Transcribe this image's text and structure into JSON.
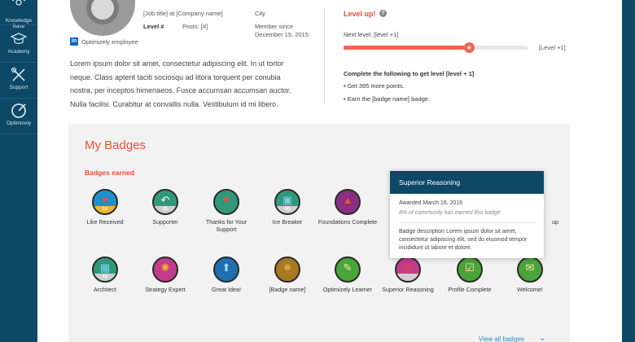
{
  "sidebar": {
    "items": [
      {
        "label": "Knowledge Base",
        "icon": "lightbulb-icon"
      },
      {
        "label": "Academy",
        "icon": "graduation-cap-icon"
      },
      {
        "label": "Support",
        "icon": "tools-icon"
      },
      {
        "label": "Optimizely",
        "icon": "optimizely-logo-icon"
      }
    ]
  },
  "profile": {
    "job_title": "[Job title] at [Company name]",
    "level": "Level #",
    "posts": "Posts: [#]",
    "city": "City",
    "member_since": "Member since December 15, 2015",
    "employee_tag": "Optimizely employee",
    "bio": "Lorem ipsum dolor sit amet, consectetur adipiscing elit. In ut tortor neque. Class aptent taciti sociosqu ad litora torquent per conubia nostra, per inceptos himenaeos. Fusce accumsan accumsan auctor. Nulla facilisi. Curabitur at convallis nulla. Vestibulum id mi libero."
  },
  "level_panel": {
    "title": "Level up!",
    "help": "?",
    "next_level": "Next level: [level +1]",
    "progress": 0.68,
    "end_label": "[Level +1]",
    "tasks_heading": "Complete the following to get level [level + 1]",
    "tasks": [
      "• Get 395 more points.",
      "• Earn the [badge name] badge."
    ]
  },
  "badges_panel": {
    "title": "My Badges",
    "subtitle": "Badges earned",
    "view_all": "View all badges",
    "badges": [
      {
        "label": "Like Received",
        "color": "#1e8fcf",
        "glyph": "♥",
        "glyph_color": "#e8503a",
        "count": "1K",
        "count_style": "gold"
      },
      {
        "label": "Supporter",
        "color": "#2e9a7a",
        "glyph": "↶",
        "glyph_color": "#ffffff",
        "count": "25",
        "count_style": "grey"
      },
      {
        "label": "Thanks for Your Support",
        "color": "#2e9a7a",
        "glyph": "♥",
        "glyph_color": "#e8503a",
        "count": "",
        "count_style": ""
      },
      {
        "label": "Ice Breaker",
        "color": "#2e9a7a",
        "glyph": "▣",
        "glyph_color": "#7cd0f0",
        "count": "50",
        "count_style": "grey"
      },
      {
        "label": "Foundations Complete",
        "color": "#8a2f82",
        "glyph": "▲",
        "glyph_color": "#e8503a",
        "count": "",
        "count_style": ""
      },
      {
        "label": "Architect",
        "color": "#2e9a7a",
        "glyph": "▦",
        "glyph_color": "#7cd0f0",
        "count": "10",
        "count_style": "grey"
      },
      {
        "label": "Strategy Expert",
        "color": "#c23b8c",
        "glyph": "✺",
        "glyph_color": "#f3b32d",
        "count": "",
        "count_style": ""
      },
      {
        "label": "Great Idea!",
        "color": "#1e6fb0",
        "glyph": "⬆",
        "glyph_color": "#9be0f7",
        "count": "",
        "count_style": ""
      },
      {
        "label": "[Badge name]",
        "color": "#a67a22",
        "glyph": "✹",
        "glyph_color": "#e0a040",
        "count": "",
        "count_style": ""
      },
      {
        "label": "Optimizely Learner",
        "color": "#4aa43a",
        "glyph": "✎",
        "glyph_color": "#f3e6b0",
        "count": "",
        "count_style": ""
      },
      {
        "label": "Superior Reasoning",
        "color": "#c23b8c",
        "glyph": "◎",
        "glyph_color": "#e8503a",
        "count": "",
        "count_style": "grey"
      },
      {
        "label": "Profile Complete",
        "color": "#4aa43a",
        "glyph": "☑",
        "glyph_color": "#f3e6b0",
        "count": "",
        "count_style": ""
      },
      {
        "label": "Welcome!",
        "color": "#4aa43a",
        "glyph": "✉",
        "glyph_color": "#f3e6b0",
        "count": "",
        "count_style": ""
      },
      {
        "label": "up",
        "color": "#c23b8c",
        "glyph": "",
        "glyph_color": "#ffffff",
        "count": "",
        "count_style": ""
      }
    ]
  },
  "tooltip": {
    "title": "Superior Reasoning",
    "awarded": "Awarded March 16, 2016",
    "stat": "8% of community has earned this badge",
    "description": "Badge description Lorem ipsum dolor sit amet, consectetur adipiscing elit, sed do eiusmod tempor incididunt ut labore et dolore."
  }
}
